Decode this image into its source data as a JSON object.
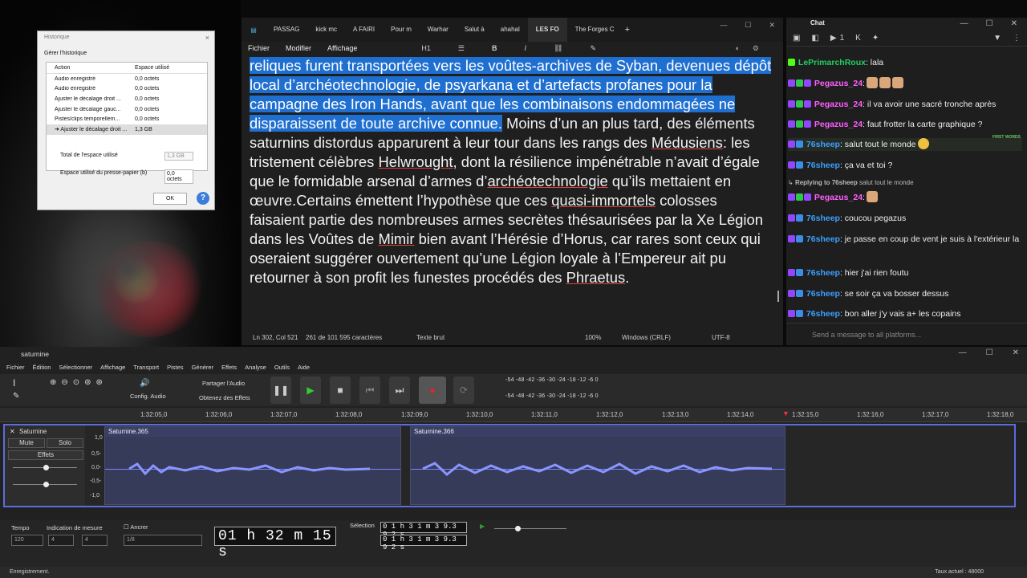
{
  "history": {
    "title": "Historique",
    "close": "×",
    "group": "Gérer l'historique",
    "headers": [
      "Action",
      "Espace utilisé"
    ],
    "rows": [
      [
        "Audio enregistré",
        "0,0 octets"
      ],
      [
        "Audio enregistré",
        "0,0 octets"
      ],
      [
        "Ajuster le décalage droit ...",
        "0,0 octets"
      ],
      [
        "Ajuster le décalage gauc...",
        "0,0 octets"
      ],
      [
        "Pistes/clips temporellem...",
        "0,0 octets"
      ],
      [
        "➜ Ajuster le décalage droit ...",
        "1,3 GB"
      ]
    ],
    "total_label": "Total de l'espace utilisé",
    "total_value": "1,3 GB",
    "clipboard_label": "Espace utilisé du presse-papier (b)",
    "clipboard_value": "0,0 octets",
    "ok": "OK",
    "help": "?"
  },
  "editor": {
    "tabs": [
      "PASSAG",
      "kick mc",
      "A FAIRI",
      "Pour m",
      "Warhar",
      "Salut à",
      "ahahal",
      "LES FO",
      "The Forges C"
    ],
    "new_tab": "+",
    "menu": [
      "Fichier",
      "Modifier",
      "Affichage"
    ],
    "heading": "H1",
    "highlighted": "reliques furent transportées vers les voûtes-archives de Syban, devenues dépôt local d’archéotechnologie, de psyarkana et d’artefacts profanes pour la campagne des Iron Hands, avant que les combinaisons endommagées ne disparaissent de toute archive connue.",
    "t1": " Moins d’un an plus tard, des éléments saturnins distordus apparurent à leur tour dans les rangs des ",
    "w1": "Médusiens",
    "t2": ": les tristement célèbres ",
    "w2": "Helwrought",
    "t3": ", dont la résilience impénétrable n’avait d’égale que le formidable arsenal d’armes d’",
    "w3": "archéotechnologie",
    "t4": " qu’ils mettaient en œuvre.Certains émettent l’hypothèse que ces ",
    "w4": "quasi-immortels",
    "t5": " colosses faisaient partie des nombreuses armes secrètes thésaurisées par la Xe Légion dans les Voûtes de ",
    "w5": "Mimir",
    "t6": " bien avant l’Hérésie d’Horus, car rares sont ceux qui oseraient suggérer ouvertement qu’une Légion loyale à l’Empereur ait pu retourner à son profit les funestes procédés des ",
    "w6": "Phraetus",
    "t7": ".",
    "status": {
      "pos": "Ln 302, Col 521",
      "chars": "261 de 101 595 caractères",
      "mode": "Texte brut",
      "zoom": "100%",
      "eol": "Windows (CRLF)",
      "enc": "UTF-8"
    }
  },
  "chat": {
    "title": "Chat",
    "count": "1",
    "first_words": "FIRST WORDS",
    "input_placeholder": "Send a message to all platforms...",
    "messages": [
      {
        "user": "LePrimarchRoux",
        "text": " lala"
      },
      {
        "user": "Pegazus_24",
        "text": ""
      },
      {
        "user": "Pegazus_24",
        "text": " il va avoir une sacré tronche après"
      },
      {
        "user": "Pegazus_24",
        "text": " faut frotter la carte graphique ?"
      },
      {
        "user": "76sheep",
        "text": " salut tout le monde"
      },
      {
        "user": "76sheep",
        "text": " ça va et toi ?"
      },
      {
        "user": "Replying to 76sheep",
        "text": " salut tout le monde"
      },
      {
        "user": "Pegazus_24",
        "text": ""
      },
      {
        "user": "76sheep",
        "text": " coucou pegazus"
      },
      {
        "user": "76sheep",
        "text": " je passe en coup de vent je suis à l'extérieur la"
      },
      {
        "user": "76sheep",
        "text": " hier j'ai rien foutu"
      },
      {
        "user": "76sheep",
        "text": " se soir ça va bosser dessus"
      },
      {
        "user": "76sheep",
        "text": " bon aller j'y vais a+ les copains"
      }
    ]
  },
  "audacity": {
    "title": "saturnine",
    "menu": [
      "Fichier",
      "Édition",
      "Sélectionner",
      "Affichage",
      "Transport",
      "Pistes",
      "Générer",
      "Effets",
      "Analyse",
      "Outils",
      "Aide"
    ],
    "share": "Partager l'Audio",
    "effects": "Obtenez des Effets",
    "config": "Config. Audio",
    "meter": "-54 -48 -42 -36 -30 -24 -18 -12 -6 0",
    "ruler": [
      "1:32:05,0",
      "1:32:06,0",
      "1:32:07,0",
      "1:32:08,0",
      "1:32:09,0",
      "1:32:10,0",
      "1:32:11,0",
      "1:32:12,0",
      "1:32:13,0",
      "1:32:14,0",
      "1:32:15,0",
      "1:32:16,0",
      "1:32:17,0",
      "1:32:18,0"
    ],
    "track_name": "Saturnine",
    "mute": "Mute",
    "solo": "Solo",
    "effets": "Effets",
    "clips": [
      "Saturnine.365",
      "Saturnine.366"
    ],
    "amp": [
      "1,0",
      "0,5-",
      "0,0-",
      "-0,5-",
      "-1,0"
    ],
    "tempo_label": "Tempo",
    "tempo": "120",
    "meas_label": "Indication de mesure",
    "meas_a": "4",
    "meas_b": "4",
    "snap": "Ancrer",
    "snap_val": "1/8",
    "time": "01 h 32 m 15 s",
    "sel_label": "Sélection",
    "sel1": "0 1 h 3 1 m 3 9.3 9 2 s",
    "sel2": "0 1 h 3 1 m 3 9.3 9 2 s",
    "status": "Enregistrement.",
    "rate": "Taux actuel : 48000"
  }
}
